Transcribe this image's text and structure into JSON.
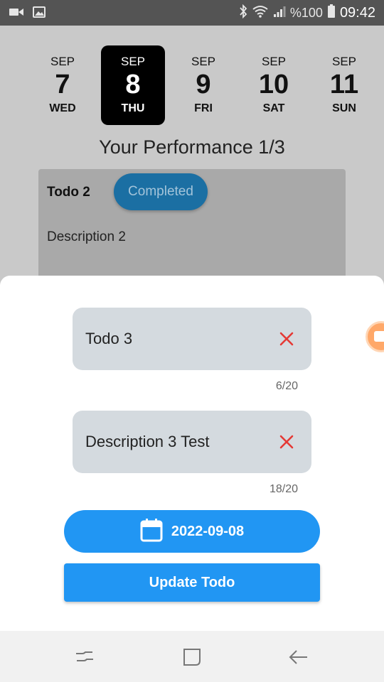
{
  "status_bar": {
    "battery_percent": "%100",
    "time": "09:42",
    "icons": [
      "video-icon",
      "image-icon",
      "bluetooth-icon",
      "wifi-icon",
      "signal-icon",
      "battery-icon"
    ]
  },
  "date_strip": [
    {
      "month": "SEP",
      "day": "7",
      "weekday": "WED",
      "selected": false
    },
    {
      "month": "SEP",
      "day": "8",
      "weekday": "THU",
      "selected": true
    },
    {
      "month": "SEP",
      "day": "9",
      "weekday": "FRI",
      "selected": false
    },
    {
      "month": "SEP",
      "day": "10",
      "weekday": "SAT",
      "selected": false
    },
    {
      "month": "SEP",
      "day": "11",
      "weekday": "SUN",
      "selected": false
    }
  ],
  "performance_title": "Your Performance 1/3",
  "todo_card": {
    "title": "Todo 2",
    "status": "Completed",
    "description": "Description 2"
  },
  "sheet": {
    "title_field": {
      "value": "Todo 3",
      "counter": "6/20"
    },
    "description_field": {
      "value": "Description 3 Test",
      "counter": "18/20"
    },
    "date_button": {
      "label": "2022-09-08",
      "icon": "calendar-icon"
    },
    "update_button": {
      "label": "Update Todo"
    }
  },
  "colors": {
    "accent": "#2196f3",
    "clear_icon": "#e53935",
    "selected_date_bg": "#000000",
    "field_bg": "#d4dadf"
  },
  "nav_bar": {
    "icons": [
      "recent-apps-icon",
      "home-icon",
      "back-icon"
    ]
  }
}
